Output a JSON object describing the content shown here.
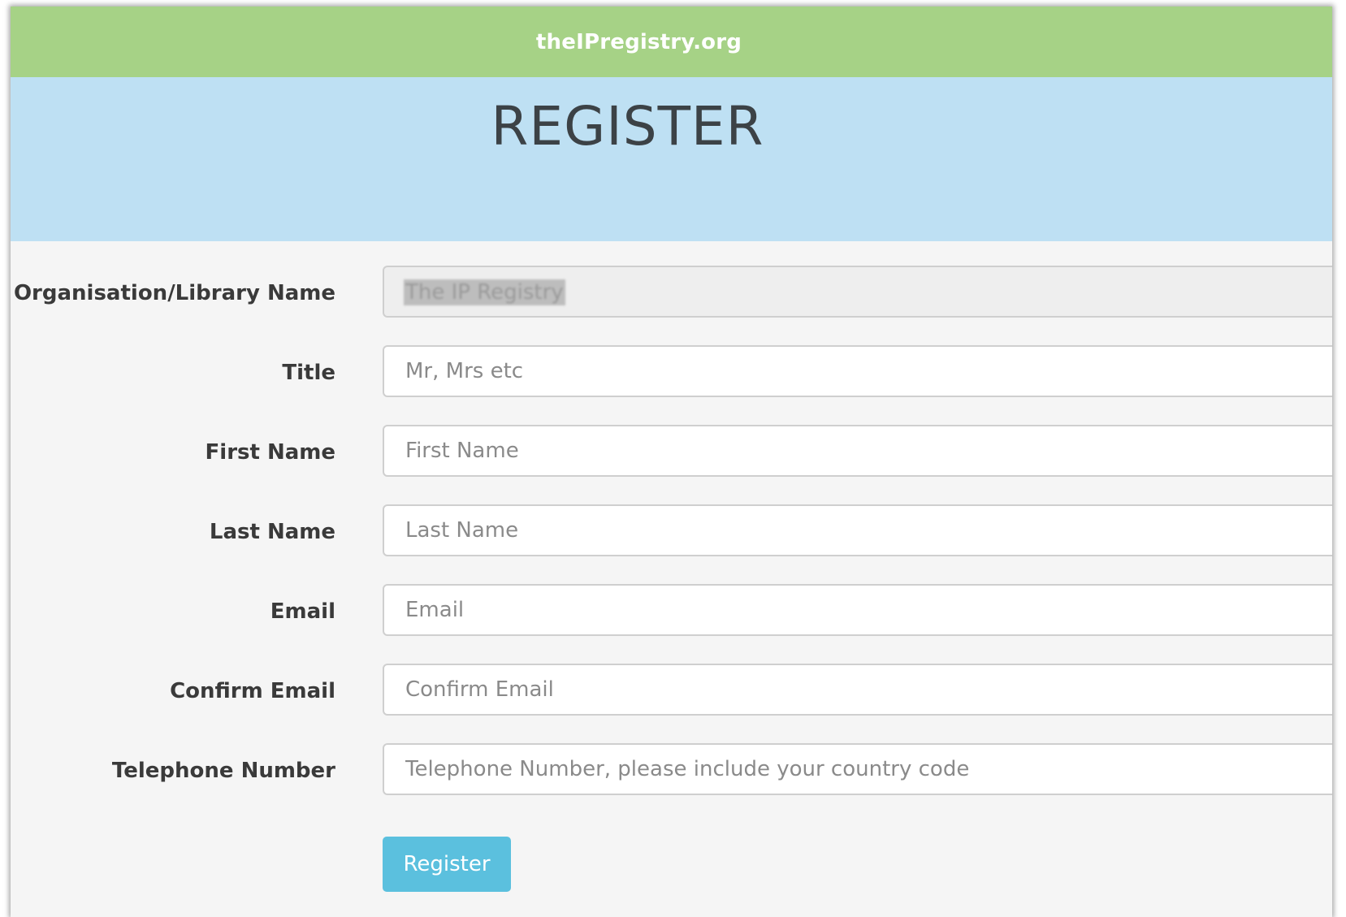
{
  "header": {
    "brand": "theIPregistry.org",
    "page_title": "REGISTER"
  },
  "form": {
    "fields": [
      {
        "label": "Organisation/Library Name",
        "value": "The IP Registry",
        "placeholder": "",
        "readonly": true
      },
      {
        "label": "Title",
        "value": "",
        "placeholder": "Mr, Mrs etc"
      },
      {
        "label": "First Name",
        "value": "",
        "placeholder": "First Name"
      },
      {
        "label": "Last Name",
        "value": "",
        "placeholder": "Last Name"
      },
      {
        "label": "Email",
        "value": "",
        "placeholder": "Email"
      },
      {
        "label": "Confirm Email",
        "value": "",
        "placeholder": "Confirm Email"
      },
      {
        "label": "Telephone Number",
        "value": "",
        "placeholder": "Telephone Number, please include your country code"
      }
    ],
    "submit_label": "Register"
  },
  "colors": {
    "topbar": "#a6d286",
    "hero": "#bee0f3",
    "button": "#5bc0de"
  }
}
